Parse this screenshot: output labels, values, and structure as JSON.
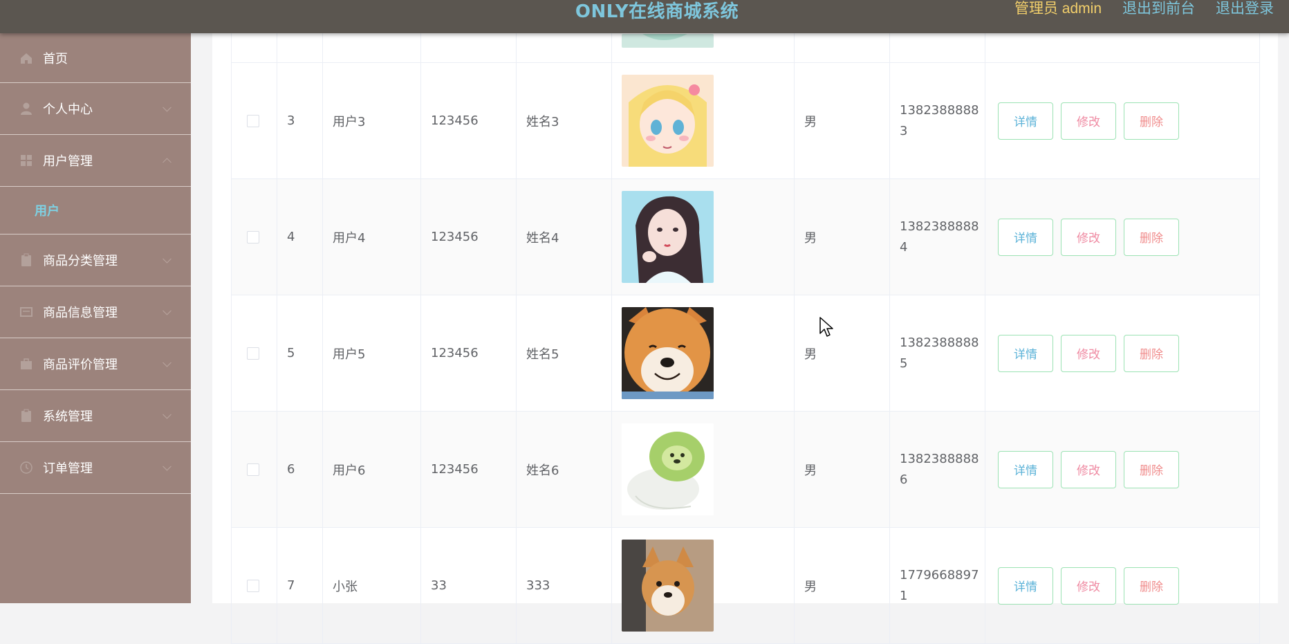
{
  "header": {
    "title": "ONLY在线商城系统",
    "user_label": "管理员 admin",
    "to_front_label": "退出到前台",
    "logout_label": "退出登录"
  },
  "sidebar": {
    "items": [
      {
        "label": "首页",
        "icon": "home-icon"
      },
      {
        "label": "个人中心",
        "icon": "user-icon"
      },
      {
        "label": "用户管理",
        "icon": "grid-icon",
        "expanded": true,
        "sub": "用户"
      },
      {
        "label": "商品分类管理",
        "icon": "clipboard-icon"
      },
      {
        "label": "商品信息管理",
        "icon": "message-icon"
      },
      {
        "label": "商品评价管理",
        "icon": "briefcase-icon"
      },
      {
        "label": "系统管理",
        "icon": "clipboard-icon"
      },
      {
        "label": "订单管理",
        "icon": "clock-icon"
      }
    ]
  },
  "table": {
    "buttons": {
      "detail": "详情",
      "edit": "修改",
      "delete": "删除"
    },
    "rows": [
      {
        "id": "3",
        "account": "用户3",
        "password": "123456",
        "name": "姓名3",
        "gender": "男",
        "phone": "13823888883"
      },
      {
        "id": "4",
        "account": "用户4",
        "password": "123456",
        "name": "姓名4",
        "gender": "男",
        "phone": "13823888884"
      },
      {
        "id": "5",
        "account": "用户5",
        "password": "123456",
        "name": "姓名5",
        "gender": "男",
        "phone": "13823888885"
      },
      {
        "id": "6",
        "account": "用户6",
        "password": "123456",
        "name": "姓名6",
        "gender": "男",
        "phone": "13823888886"
      },
      {
        "id": "7",
        "account": "小张",
        "password": "33",
        "name": "333",
        "gender": "男",
        "phone": "17796688971"
      }
    ]
  },
  "colors": {
    "header_bg": "#5b5650",
    "title": "#7ec6dc",
    "admin_text": "#f2cf6b",
    "sidebar_bg": "#9c837c",
    "submenu_active": "#7ed0e2",
    "button_border": "#9be2b3"
  }
}
